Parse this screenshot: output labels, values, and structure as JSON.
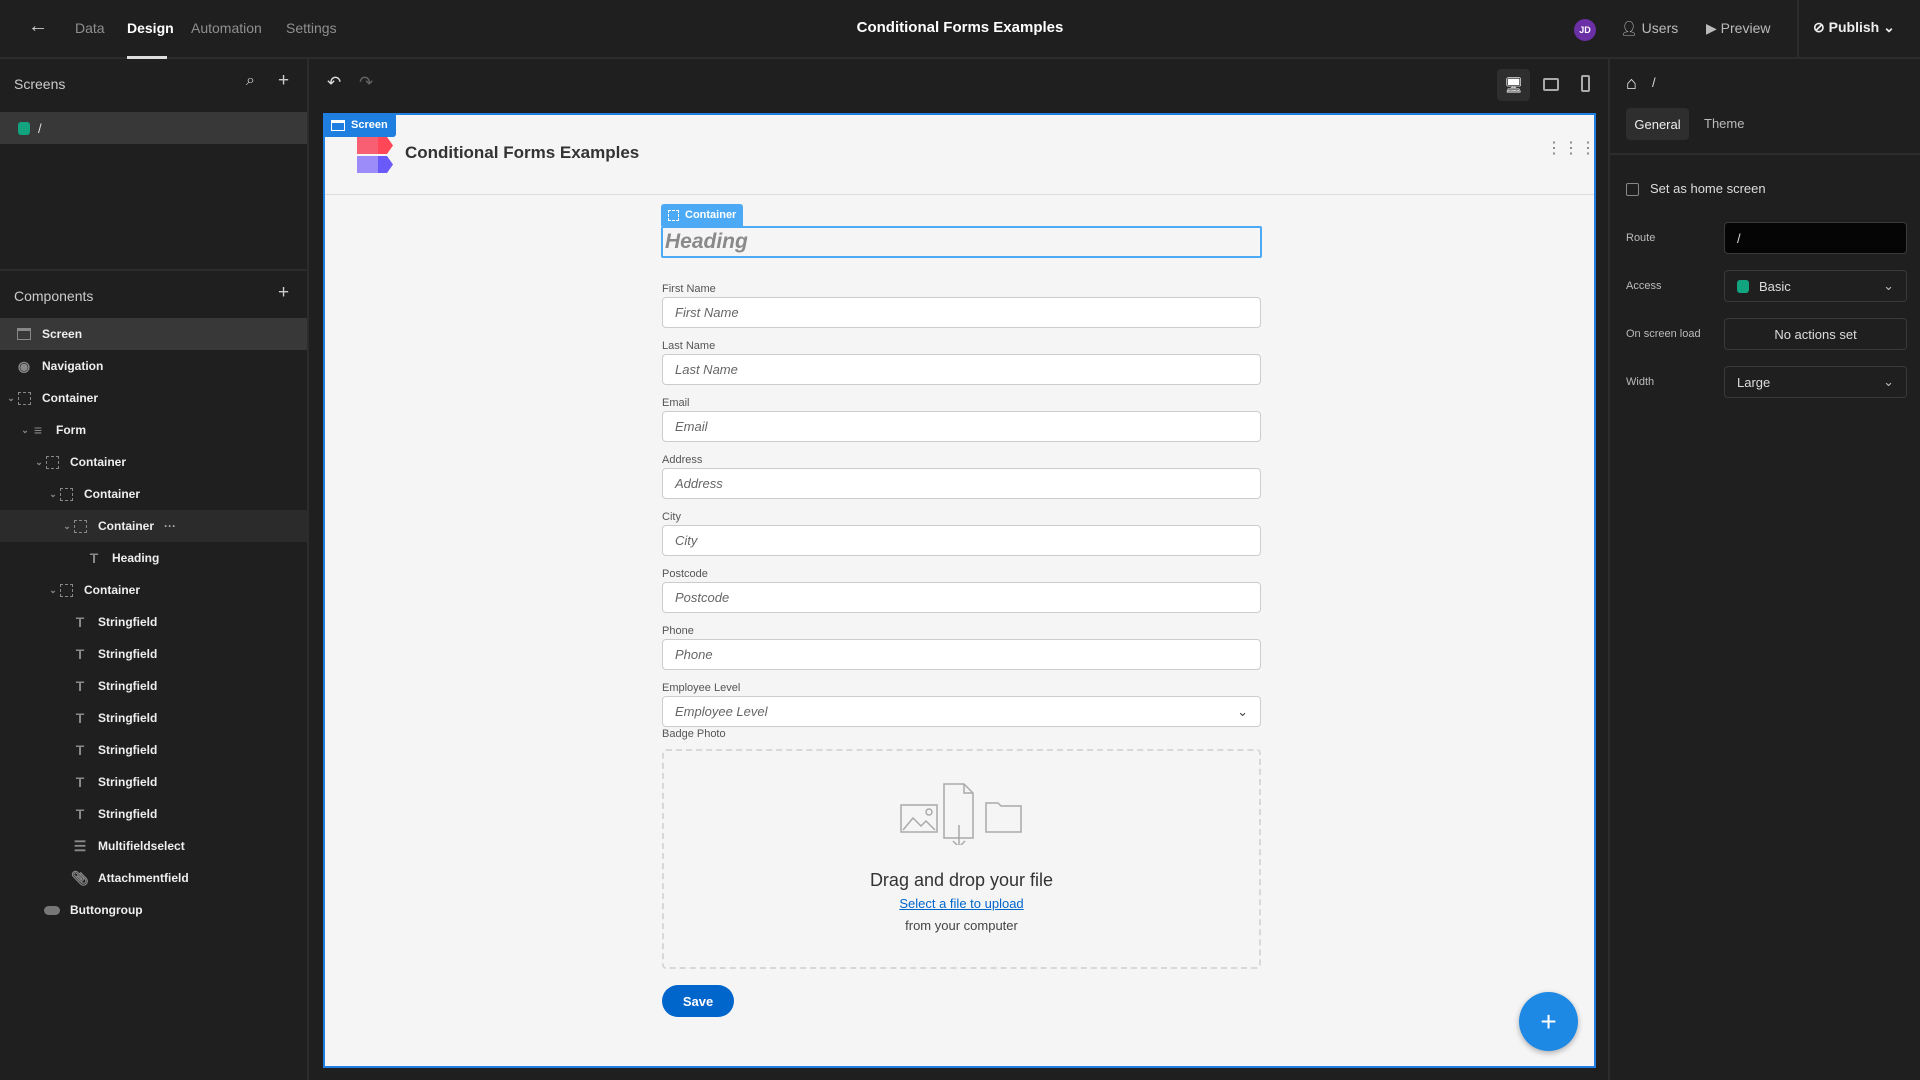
{
  "topbar": {
    "tabs": [
      {
        "label": "Data"
      },
      {
        "label": "Design",
        "active": true
      },
      {
        "label": "Automation"
      },
      {
        "label": "Settings"
      }
    ],
    "title": "Conditional Forms Examples",
    "avatar": "JD",
    "users": "Users",
    "preview": "Preview",
    "publish": "Publish"
  },
  "screens": {
    "title": "Screens",
    "items": [
      {
        "route": "/",
        "color": "#12a47f"
      }
    ]
  },
  "components": {
    "title": "Components",
    "tree": [
      {
        "label": "Screen",
        "icon": "screen-icon",
        "depth": 0,
        "selected": true
      },
      {
        "label": "Navigation",
        "icon": "eye-icon",
        "depth": 0
      },
      {
        "label": "Container",
        "icon": "container-icon",
        "depth": 0,
        "chevron": true
      },
      {
        "label": "Form",
        "icon": "form-icon",
        "depth": 1,
        "chevron": true
      },
      {
        "label": "Container",
        "icon": "container-icon",
        "depth": 2,
        "chevron": true
      },
      {
        "label": "Container",
        "icon": "container-icon",
        "depth": 3,
        "chevron": true
      },
      {
        "label": "Container",
        "icon": "container-icon",
        "depth": 4,
        "chevron": true,
        "hover": true,
        "more": "···"
      },
      {
        "label": "Heading",
        "icon": "text-icon",
        "depth": 5
      },
      {
        "label": "Container",
        "icon": "container-icon",
        "depth": 3,
        "chevron": true
      },
      {
        "label": "Stringfield",
        "icon": "text-icon",
        "depth": 4
      },
      {
        "label": "Stringfield",
        "icon": "text-icon",
        "depth": 4
      },
      {
        "label": "Stringfield",
        "icon": "text-icon",
        "depth": 4
      },
      {
        "label": "Stringfield",
        "icon": "text-icon",
        "depth": 4
      },
      {
        "label": "Stringfield",
        "icon": "text-icon",
        "depth": 4
      },
      {
        "label": "Stringfield",
        "icon": "text-icon",
        "depth": 4
      },
      {
        "label": "Stringfield",
        "icon": "text-icon",
        "depth": 4
      },
      {
        "label": "Multifieldselect",
        "icon": "list-icon",
        "depth": 4
      },
      {
        "label": "Attachmentfield",
        "icon": "paperclip-icon",
        "depth": 4
      },
      {
        "label": "Buttongroup",
        "icon": "button-icon",
        "depth": 2
      }
    ]
  },
  "canvas": {
    "screen_tag": "Screen",
    "app_title": "Conditional Forms Examples",
    "container_tag": "Container",
    "heading": "Heading",
    "fields": [
      {
        "label": "First Name",
        "placeholder": "First Name"
      },
      {
        "label": "Last Name",
        "placeholder": "Last Name"
      },
      {
        "label": "Email",
        "placeholder": "Email"
      },
      {
        "label": "Address",
        "placeholder": "Address"
      },
      {
        "label": "City",
        "placeholder": "City"
      },
      {
        "label": "Postcode",
        "placeholder": "Postcode"
      },
      {
        "label": "Phone",
        "placeholder": "Phone"
      },
      {
        "label": "Employee Level",
        "placeholder": "Employee Level",
        "type": "select"
      }
    ],
    "badge": {
      "label": "Badge Photo",
      "drag": "Drag and drop your file",
      "link": "Select a file to upload",
      "from": "from your computer"
    },
    "save": "Save",
    "accent": "#0066cc"
  },
  "settings": {
    "breadcrumb": "/",
    "tabs": [
      {
        "label": "General",
        "active": true
      },
      {
        "label": "Theme"
      }
    ],
    "home_checkbox": "Set as home screen",
    "home_checked": false,
    "route_label": "Route",
    "route": "/",
    "access_label": "Access",
    "access": "Basic",
    "access_color": "#12a47f",
    "load_label": "On screen load",
    "load": "No actions set",
    "width_label": "Width",
    "width": "Large"
  }
}
